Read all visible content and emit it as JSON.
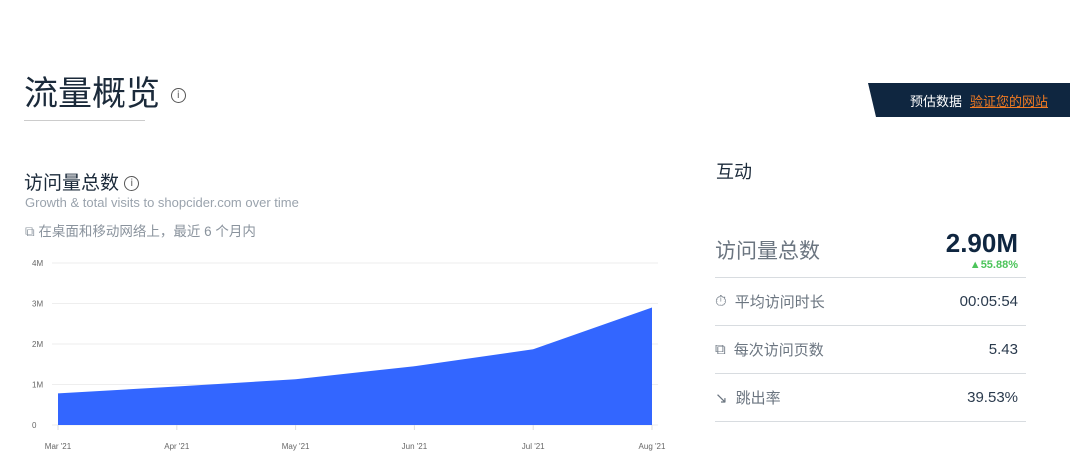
{
  "header": {
    "title": "流量概览",
    "info_icon": "i"
  },
  "banner": {
    "label": "预估数据",
    "link": "验证您的网站"
  },
  "visits_card": {
    "title": "访问量总数",
    "subtitle": "Growth & total visits to shopcider.com over time",
    "scope": "在桌面和移动网络上，最近 6 个月内"
  },
  "engagement": {
    "title": "互动",
    "total_label": "访问量总数",
    "total_value": "2.90M",
    "change": "55.88%",
    "metrics": [
      {
        "icon": "clock-icon",
        "label": "平均访问时长",
        "value": "00:05:54"
      },
      {
        "icon": "pages-icon",
        "label": "每次访问页数",
        "value": "5.43"
      },
      {
        "icon": "bounce-icon",
        "label": "跳出率",
        "value": "39.53%"
      }
    ]
  },
  "chart_data": {
    "type": "area",
    "title": "访问量总数",
    "categories": [
      "Mar '21",
      "Apr '21",
      "May '21",
      "Jun '21",
      "Jul '21",
      "Aug '21"
    ],
    "values": [
      780000,
      950000,
      1130000,
      1450000,
      1870000,
      2900000
    ],
    "yticks": [
      "0",
      "1M",
      "2M",
      "3M",
      "4M"
    ],
    "ylim": [
      0,
      4000000
    ],
    "color": "#3366ff",
    "grid": true
  }
}
